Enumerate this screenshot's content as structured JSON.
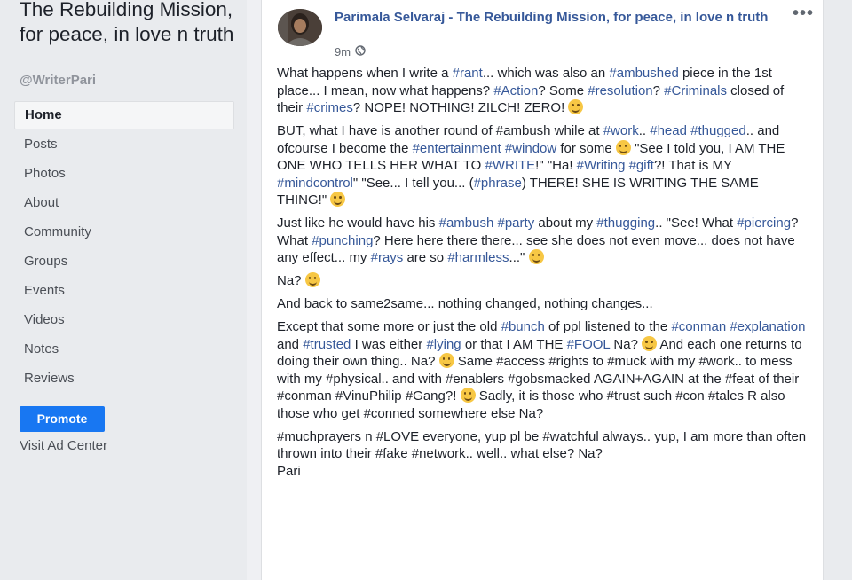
{
  "sidebar": {
    "page_name": "The Rebuilding Mission, for peace, in love n truth",
    "handle": "@WriterPari",
    "nav": [
      "Home",
      "Posts",
      "Photos",
      "About",
      "Community",
      "Groups",
      "Events",
      "Videos",
      "Notes",
      "Reviews"
    ],
    "promote_label": "Promote",
    "ad_center_label": "Visit Ad Center"
  },
  "post": {
    "author": "Parimala Selvaraj - The Rebuilding Mission, for peace, in love n truth",
    "time": "9m",
    "privacy_icon": "globe-icon",
    "more_icon": "ellipsis-icon",
    "paragraphs": [
      [
        {
          "t": "What happens when I write a "
        },
        {
          "t": "#rant",
          "tag": true
        },
        {
          "t": "... which was also an "
        },
        {
          "t": "#ambushed",
          "tag": true
        },
        {
          "t": " piece in the 1st place... I mean, now what happens? "
        },
        {
          "t": "#Action",
          "tag": true
        },
        {
          "t": "? Some "
        },
        {
          "t": "#resolution",
          "tag": true
        },
        {
          "t": "? "
        },
        {
          "t": "#Criminals",
          "tag": true
        },
        {
          "t": " closed of their "
        },
        {
          "t": "#crimes",
          "tag": true
        },
        {
          "t": "? NOPE! NOTHING! ZILCH! ZERO! "
        },
        {
          "emoji": true
        }
      ],
      [
        {
          "t": "BUT, what I have is another round of #ambush while at "
        },
        {
          "t": "#work",
          "tag": true
        },
        {
          "t": ".. "
        },
        {
          "t": "#head",
          "tag": true
        },
        {
          "t": " "
        },
        {
          "t": "#thugged",
          "tag": true
        },
        {
          "t": ".. and ofcourse I become the "
        },
        {
          "t": "#entertainment",
          "tag": true
        },
        {
          "t": " "
        },
        {
          "t": "#window",
          "tag": true
        },
        {
          "t": " for some "
        },
        {
          "emoji": true
        },
        {
          "t": " \"See I told you, I AM THE ONE WHO TELLS HER WHAT TO "
        },
        {
          "t": "#WRITE",
          "tag": true
        },
        {
          "t": "!\" \"Ha! "
        },
        {
          "t": "#Writing",
          "tag": true
        },
        {
          "t": " "
        },
        {
          "t": "#gift",
          "tag": true
        },
        {
          "t": "?! That is MY "
        },
        {
          "t": "#mindcontrol",
          "tag": true
        },
        {
          "t": "\" \"See... I tell you... ("
        },
        {
          "t": "#phrase",
          "tag": true
        },
        {
          "t": ") THERE! SHE IS WRITING THE SAME THING!\" "
        },
        {
          "emoji": true
        }
      ],
      [
        {
          "t": "Just like he would have his "
        },
        {
          "t": "#ambush",
          "tag": true
        },
        {
          "t": " "
        },
        {
          "t": "#party",
          "tag": true
        },
        {
          "t": " about my "
        },
        {
          "t": "#thugging",
          "tag": true
        },
        {
          "t": ".. \"See! What "
        },
        {
          "t": "#piercing",
          "tag": true
        },
        {
          "t": "? What "
        },
        {
          "t": "#punching",
          "tag": true
        },
        {
          "t": "? Here here there there... see she does not even move... does not have any effect... my "
        },
        {
          "t": "#rays",
          "tag": true
        },
        {
          "t": " are so "
        },
        {
          "t": "#harmless",
          "tag": true
        },
        {
          "t": "...\" "
        },
        {
          "emoji": true
        }
      ],
      [
        {
          "t": "Na? "
        },
        {
          "emoji": true
        }
      ],
      [
        {
          "t": "And back to same2same... nothing changed, nothing changes..."
        }
      ],
      [
        {
          "t": "Except that some more or just the old "
        },
        {
          "t": "#bunch",
          "tag": true
        },
        {
          "t": " of ppl listened to the "
        },
        {
          "t": "#conman",
          "tag": true
        },
        {
          "t": " "
        },
        {
          "t": "#explanation",
          "tag": true
        },
        {
          "t": " and "
        },
        {
          "t": "#trusted",
          "tag": true
        },
        {
          "t": " I was either "
        },
        {
          "t": "#lying",
          "tag": true
        },
        {
          "t": " or that I AM THE "
        },
        {
          "t": "#FOOL",
          "tag": true
        },
        {
          "t": " Na? "
        },
        {
          "emoji": true
        },
        {
          "t": " And each one returns to doing their own thing.. Na? "
        },
        {
          "emoji": true
        },
        {
          "t": " Same #access #rights to #muck with my #work.. to mess with my #physical.. and with #enablers #gobsmacked AGAIN+AGAIN at the #feat of their #conman #VinuPhilip #Gang?! "
        },
        {
          "emoji": true
        },
        {
          "t": " Sadly, it is those who #trust such #con #tales R also those who get #conned somewhere else Na?"
        }
      ],
      [
        {
          "t": "#muchprayers n #LOVE everyone, yup pl be #watchful always.. yup, I am more than often thrown into their #fake #network.. well.. what else? Na?"
        },
        {
          "br": true
        },
        {
          "t": "Pari"
        }
      ]
    ]
  }
}
